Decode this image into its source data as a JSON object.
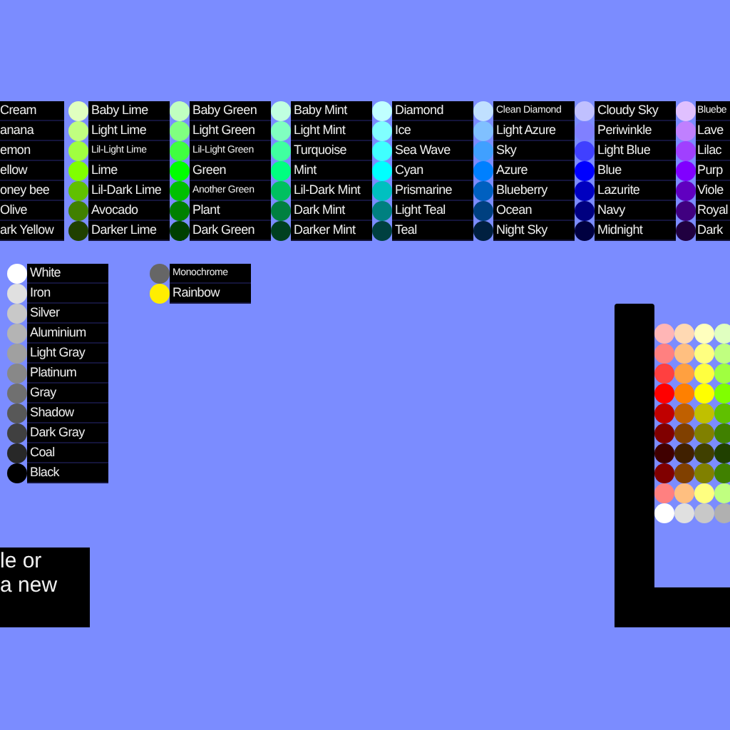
{
  "palette_columns": [
    {
      "items": [
        {
          "label": "Cream"
        },
        {
          "label": "anana"
        },
        {
          "label": "emon"
        },
        {
          "label": "ellow"
        },
        {
          "label": "oney bee"
        },
        {
          "label": "Olive"
        },
        {
          "label": "ark Yellow"
        }
      ]
    },
    {
      "items": [
        {
          "label": "Baby Lime",
          "color": "#e0ffc0"
        },
        {
          "label": "Light Lime",
          "color": "#c0ff80"
        },
        {
          "label": "Lil-Light Lime",
          "color": "#a0ff40",
          "small": true
        },
        {
          "label": "Lime",
          "color": "#80ff00"
        },
        {
          "label": "Lil-Dark Lime",
          "color": "#60c000"
        },
        {
          "label": "Avocado",
          "color": "#408000"
        },
        {
          "label": "Darker Lime",
          "color": "#204000"
        }
      ]
    },
    {
      "items": [
        {
          "label": "Baby Green",
          "color": "#c0ffc0"
        },
        {
          "label": "Light Green",
          "color": "#80ff80"
        },
        {
          "label": "Lil-Light Green",
          "color": "#40ff40",
          "small": true
        },
        {
          "label": "Green",
          "color": "#00ff00"
        },
        {
          "label": "Another Green",
          "color": "#00c000",
          "small": true
        },
        {
          "label": "Plant",
          "color": "#008000"
        },
        {
          "label": "Dark Green",
          "color": "#004000"
        }
      ]
    },
    {
      "items": [
        {
          "label": "Baby Mint",
          "color": "#c0ffe0"
        },
        {
          "label": "Light Mint",
          "color": "#80ffc0"
        },
        {
          "label": "Turquoise",
          "color": "#40ffa0"
        },
        {
          "label": "Mint",
          "color": "#00ff80"
        },
        {
          "label": "Lil-Dark Mint",
          "color": "#00c060"
        },
        {
          "label": "Dark Mint",
          "color": "#008040"
        },
        {
          "label": "Darker Mint",
          "color": "#004020"
        }
      ]
    },
    {
      "items": [
        {
          "label": "Diamond",
          "color": "#c0ffff"
        },
        {
          "label": "Ice",
          "color": "#80ffff"
        },
        {
          "label": "Sea Wave",
          "color": "#40ffff"
        },
        {
          "label": "Cyan",
          "color": "#00ffff"
        },
        {
          "label": "Prismarine",
          "color": "#00c0c0"
        },
        {
          "label": "Light Teal",
          "color": "#008080"
        },
        {
          "label": "Teal",
          "color": "#004040"
        }
      ]
    },
    {
      "items": [
        {
          "label": "Clean Diamond",
          "color": "#c0e0ff",
          "small": true
        },
        {
          "label": "Light Azure",
          "color": "#80c0ff"
        },
        {
          "label": "Sky",
          "color": "#40a0ff"
        },
        {
          "label": "Azure",
          "color": "#0080ff"
        },
        {
          "label": "Blueberry",
          "color": "#0060c0"
        },
        {
          "label": "Ocean",
          "color": "#004080"
        },
        {
          "label": "Night Sky",
          "color": "#002040"
        }
      ]
    },
    {
      "items": [
        {
          "label": "Cloudy Sky",
          "color": "#c0c0ff"
        },
        {
          "label": "Periwinkle",
          "color": "#8080ff"
        },
        {
          "label": "Light Blue",
          "color": "#4040ff"
        },
        {
          "label": "Blue",
          "color": "#0000ff"
        },
        {
          "label": "Lazurite",
          "color": "#0000c0"
        },
        {
          "label": "Navy",
          "color": "#000080"
        },
        {
          "label": "Midnight",
          "color": "#000040"
        }
      ]
    },
    {
      "items": [
        {
          "label": "Bluebe",
          "color": "#e0c0ff",
          "small": true
        },
        {
          "label": "Lave",
          "color": "#c080ff"
        },
        {
          "label": "Lilac",
          "color": "#a040ff"
        },
        {
          "label": "Purp",
          "color": "#8000ff"
        },
        {
          "label": "Viole",
          "color": "#6000c0"
        },
        {
          "label": "Royal",
          "color": "#400080"
        },
        {
          "label": "Dark",
          "color": "#200040"
        }
      ]
    }
  ],
  "gray_column": {
    "items": [
      {
        "label": "White",
        "color": "#ffffff"
      },
      {
        "label": "Iron",
        "color": "#e0e0e0"
      },
      {
        "label": "Silver",
        "color": "#c8c8c8"
      },
      {
        "label": "Aluminium",
        "color": "#b4b4b4"
      },
      {
        "label": "Light Gray",
        "color": "#a0a0a0"
      },
      {
        "label": "Platinum",
        "color": "#888888"
      },
      {
        "label": "Gray",
        "color": "#707070"
      },
      {
        "label": "Shadow",
        "color": "#585858"
      },
      {
        "label": "Dark Gray",
        "color": "#404040"
      },
      {
        "label": "Coal",
        "color": "#282828"
      },
      {
        "label": "Black",
        "color": "#000000"
      }
    ]
  },
  "special_column": {
    "items": [
      {
        "label": "Monochrome",
        "color": "#666666",
        "small": true
      },
      {
        "label": "Rainbow",
        "color": "#ffee00"
      }
    ]
  },
  "message_lines": [
    "le or",
    "a new"
  ],
  "swatch_grid": [
    {
      "swatches": [
        {
          "color": "#ffb6b6"
        },
        {
          "color": "#ffd9b3"
        },
        {
          "color": "#ffffbe"
        },
        {
          "color": "#e0ffc0"
        }
      ]
    },
    {
      "swatches": [
        {
          "color": "#ff8080"
        },
        {
          "color": "#ffbf80"
        },
        {
          "color": "#ffff80"
        },
        {
          "color": "#c0ff80"
        }
      ]
    },
    {
      "swatches": [
        {
          "color": "#ff4040"
        },
        {
          "color": "#ffa040"
        },
        {
          "color": "#ffff40"
        },
        {
          "color": "#a0ff40"
        }
      ]
    },
    {
      "swatches": [
        {
          "color": "#ff0000"
        },
        {
          "color": "#ff8000"
        },
        {
          "color": "#ffff00"
        },
        {
          "color": "#80ff00"
        }
      ]
    },
    {
      "swatches": [
        {
          "color": "#c00000"
        },
        {
          "color": "#c06000"
        },
        {
          "color": "#c0c000"
        },
        {
          "color": "#60c000"
        }
      ]
    },
    {
      "swatches": [
        {
          "color": "#800000"
        },
        {
          "color": "#804000"
        },
        {
          "color": "#808000"
        },
        {
          "color": "#408000"
        }
      ]
    },
    {
      "swatches": [
        {
          "color": "#400000"
        },
        {
          "color": "#402000"
        },
        {
          "color": "#404000"
        },
        {
          "color": "#204000"
        }
      ]
    },
    {
      "swatches": [
        {
          "color": "#800000"
        },
        {
          "color": "#804000"
        },
        {
          "color": "#808000"
        },
        {
          "color": "#408000"
        }
      ]
    },
    {
      "swatches": [
        {
          "color": "#ff8080"
        },
        {
          "color": "#ffbf80"
        },
        {
          "color": "#ffff80"
        },
        {
          "color": "#c0ff80"
        }
      ]
    },
    {
      "swatches": [
        {
          "color": "#ffffff"
        },
        {
          "color": "#e0e0e0"
        },
        {
          "color": "#c8c8c8"
        },
        {
          "color": "#b0b0b0"
        }
      ]
    }
  ]
}
